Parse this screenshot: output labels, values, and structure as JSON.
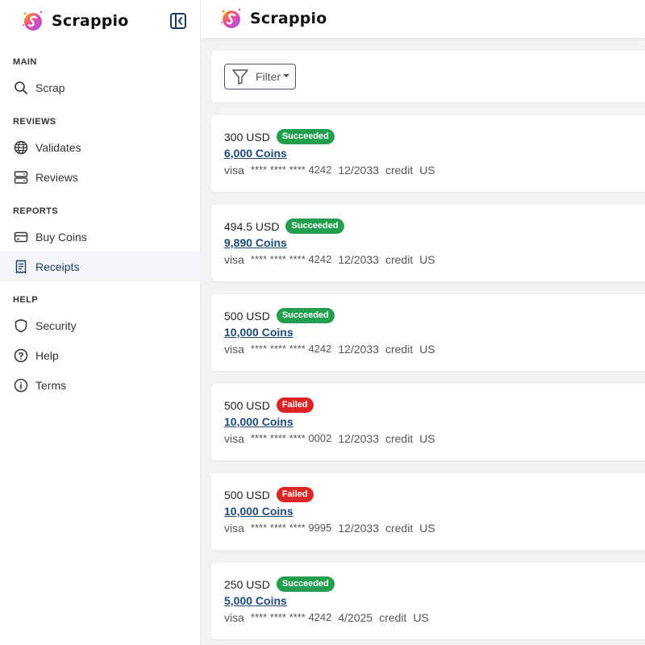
{
  "app": {
    "name": "Scrappio"
  },
  "sidebar": {
    "sections": [
      {
        "label": "MAIN"
      },
      {
        "label": "REVIEWS"
      },
      {
        "label": "REPORTS"
      },
      {
        "label": "HELP"
      }
    ],
    "items": [
      {
        "label": "Scrap",
        "icon": "search-icon"
      },
      {
        "label": "Validates",
        "icon": "globe-icon"
      },
      {
        "label": "Reviews",
        "icon": "server-icon"
      },
      {
        "label": "Buy Coins",
        "icon": "credit-card-icon"
      },
      {
        "label": "Receipts",
        "icon": "receipt-icon",
        "active": true
      },
      {
        "label": "Security",
        "icon": "shield-icon"
      },
      {
        "label": "Help",
        "icon": "question-circle-icon"
      },
      {
        "label": "Terms",
        "icon": "info-circle-icon"
      }
    ]
  },
  "filter": {
    "label": "Filter"
  },
  "receipts": [
    {
      "amount": "300 USD",
      "status": "Succeeded",
      "coins": "6,000 Coins",
      "brand": "visa",
      "card": "**** **** **** 4242",
      "expiry": "12/2033",
      "funding": "credit",
      "country": "US"
    },
    {
      "amount": "494.5 USD",
      "status": "Succeeded",
      "coins": "9,890 Coins",
      "brand": "visa",
      "card": "**** **** **** 4242",
      "expiry": "12/2033",
      "funding": "credit",
      "country": "US"
    },
    {
      "amount": "500 USD",
      "status": "Succeeded",
      "coins": "10,000 Coins",
      "brand": "visa",
      "card": "**** **** **** 4242",
      "expiry": "12/2033",
      "funding": "credit",
      "country": "US"
    },
    {
      "amount": "500 USD",
      "status": "Failed",
      "coins": "10,000 Coins",
      "brand": "visa",
      "card": "**** **** **** 0002",
      "expiry": "12/2033",
      "funding": "credit",
      "country": "US"
    },
    {
      "amount": "500 USD",
      "status": "Failed",
      "coins": "10,000 Coins",
      "brand": "visa",
      "card": "**** **** **** 9995",
      "expiry": "12/2033",
      "funding": "credit",
      "country": "US"
    },
    {
      "amount": "250 USD",
      "status": "Succeeded",
      "coins": "5,000 Coins",
      "brand": "visa",
      "card": "**** **** **** 4242",
      "expiry": "4/2025",
      "funding": "credit",
      "country": "US"
    }
  ],
  "colors": {
    "succeeded": "#219f4f",
    "failed": "#dc2626",
    "link": "#1e4a7a",
    "active_bg": "#f3f5f8"
  }
}
